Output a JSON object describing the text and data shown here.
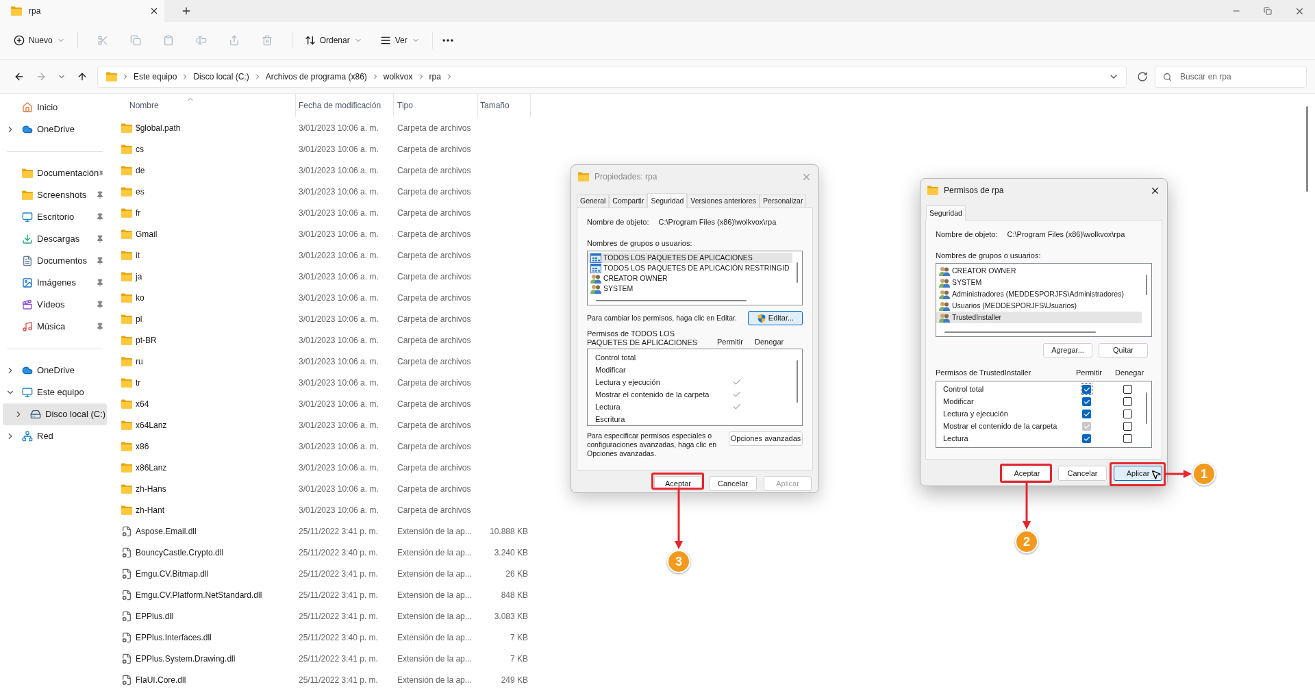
{
  "window": {
    "tab_title": "rpa"
  },
  "toolbar": {
    "new": "Nuevo",
    "sort": "Ordenar",
    "view": "Ver"
  },
  "address": {
    "path": [
      "Este equipo",
      "Disco local (C:)",
      "Archivos de programa (x86)",
      "wolkvox",
      "rpa"
    ],
    "search_placeholder": "Buscar en rpa"
  },
  "sidebar": {
    "groups": [
      {
        "items": [
          {
            "label": "Inicio",
            "kind": "home",
            "pinned": false,
            "expandable": false,
            "expanded": false,
            "selected": false
          },
          {
            "label": "OneDrive",
            "kind": "cloud",
            "pinned": false,
            "expandable": true,
            "expanded": false,
            "selected": false
          }
        ]
      },
      {
        "items": [
          {
            "label": "Documentación",
            "kind": "folder",
            "pinned": true,
            "expandable": false,
            "expanded": false,
            "selected": false
          },
          {
            "label": "Screenshots",
            "kind": "folder",
            "pinned": true,
            "expandable": false,
            "expanded": false,
            "selected": false
          },
          {
            "label": "Escritorio",
            "kind": "desktop",
            "pinned": true,
            "expandable": false,
            "expanded": false,
            "selected": false
          },
          {
            "label": "Descargas",
            "kind": "download",
            "pinned": true,
            "expandable": false,
            "expanded": false,
            "selected": false
          },
          {
            "label": "Documentos",
            "kind": "document",
            "pinned": true,
            "expandable": false,
            "expanded": false,
            "selected": false
          },
          {
            "label": "Imágenes",
            "kind": "image",
            "pinned": true,
            "expandable": false,
            "expanded": false,
            "selected": false
          },
          {
            "label": "Vídeos",
            "kind": "video",
            "pinned": true,
            "expandable": false,
            "expanded": false,
            "selected": false
          },
          {
            "label": "Música",
            "kind": "music",
            "pinned": true,
            "expandable": false,
            "expanded": false,
            "selected": false
          }
        ]
      },
      {
        "items": [
          {
            "label": "OneDrive",
            "kind": "cloud",
            "pinned": false,
            "expandable": true,
            "expanded": false,
            "selected": false
          },
          {
            "label": "Este equipo",
            "kind": "pc",
            "pinned": false,
            "expandable": true,
            "expanded": true,
            "selected": false,
            "children": [
              {
                "label": "Disco local (C:)",
                "kind": "drive",
                "expandable": true,
                "expanded": false,
                "selected": true
              }
            ]
          },
          {
            "label": "Red",
            "kind": "network",
            "pinned": false,
            "expandable": true,
            "expanded": false,
            "selected": false
          }
        ]
      }
    ]
  },
  "table": {
    "columns": [
      "Nombre",
      "Fecha de modificación",
      "Tipo",
      "Tamaño"
    ],
    "rows": [
      {
        "kind": "folder",
        "name": "$global.path",
        "date": "3/01/2023 10:06 a. m.",
        "type": "Carpeta de archivos"
      },
      {
        "kind": "folder",
        "name": "cs",
        "date": "3/01/2023 10:06 a. m.",
        "type": "Carpeta de archivos"
      },
      {
        "kind": "folder",
        "name": "de",
        "date": "3/01/2023 10:06 a. m.",
        "type": "Carpeta de archivos"
      },
      {
        "kind": "folder",
        "name": "es",
        "date": "3/01/2023 10:06 a. m.",
        "type": "Carpeta de archivos"
      },
      {
        "kind": "folder",
        "name": "fr",
        "date": "3/01/2023 10:06 a. m.",
        "type": "Carpeta de archivos"
      },
      {
        "kind": "folder",
        "name": "Gmail",
        "date": "3/01/2023 10:06 a. m.",
        "type": "Carpeta de archivos"
      },
      {
        "kind": "folder",
        "name": "it",
        "date": "3/01/2023 10:06 a. m.",
        "type": "Carpeta de archivos"
      },
      {
        "kind": "folder",
        "name": "ja",
        "date": "3/01/2023 10:06 a. m.",
        "type": "Carpeta de archivos"
      },
      {
        "kind": "folder",
        "name": "ko",
        "date": "3/01/2023 10:06 a. m.",
        "type": "Carpeta de archivos"
      },
      {
        "kind": "folder",
        "name": "pl",
        "date": "3/01/2023 10:06 a. m.",
        "type": "Carpeta de archivos"
      },
      {
        "kind": "folder",
        "name": "pt-BR",
        "date": "3/01/2023 10:06 a. m.",
        "type": "Carpeta de archivos"
      },
      {
        "kind": "folder",
        "name": "ru",
        "date": "3/01/2023 10:06 a. m.",
        "type": "Carpeta de archivos"
      },
      {
        "kind": "folder",
        "name": "tr",
        "date": "3/01/2023 10:06 a. m.",
        "type": "Carpeta de archivos"
      },
      {
        "kind": "folder",
        "name": "x64",
        "date": "3/01/2023 10:06 a. m.",
        "type": "Carpeta de archivos"
      },
      {
        "kind": "folder",
        "name": "x64Lanz",
        "date": "3/01/2023 10:06 a. m.",
        "type": "Carpeta de archivos"
      },
      {
        "kind": "folder",
        "name": "x86",
        "date": "3/01/2023 10:06 a. m.",
        "type": "Carpeta de archivos"
      },
      {
        "kind": "folder",
        "name": "x86Lanz",
        "date": "3/01/2023 10:06 a. m.",
        "type": "Carpeta de archivos"
      },
      {
        "kind": "folder",
        "name": "zh-Hans",
        "date": "3/01/2023 10:06 a. m.",
        "type": "Carpeta de archivos"
      },
      {
        "kind": "folder",
        "name": "zh-Hant",
        "date": "3/01/2023 10:06 a. m.",
        "type": "Carpeta de archivos"
      },
      {
        "kind": "dll",
        "name": "Aspose.Email.dll",
        "date": "25/11/2022 3:41 p. m.",
        "type": "Extensión de la ap...",
        "size": "10.888 KB"
      },
      {
        "kind": "dll",
        "name": "BouncyCastle.Crypto.dll",
        "date": "25/11/2022 3:40 p. m.",
        "type": "Extensión de la ap...",
        "size": "3.240 KB"
      },
      {
        "kind": "dll",
        "name": "Emgu.CV.Bitmap.dll",
        "date": "25/11/2022 3:41 p. m.",
        "type": "Extensión de la ap...",
        "size": "26 KB"
      },
      {
        "kind": "dll",
        "name": "Emgu.CV.Platform.NetStandard.dll",
        "date": "25/11/2022 3:41 p. m.",
        "type": "Extensión de la ap...",
        "size": "848 KB"
      },
      {
        "kind": "dll",
        "name": "EPPlus.dll",
        "date": "25/11/2022 3:41 p. m.",
        "type": "Extensión de la ap...",
        "size": "3.083 KB"
      },
      {
        "kind": "dll",
        "name": "EPPlus.Interfaces.dll",
        "date": "25/11/2022 3:40 p. m.",
        "type": "Extensión de la ap...",
        "size": "7 KB"
      },
      {
        "kind": "dll",
        "name": "EPPlus.System.Drawing.dll",
        "date": "25/11/2022 3:41 p. m.",
        "type": "Extensión de la ap...",
        "size": "7 KB"
      },
      {
        "kind": "dll",
        "name": "FlaUI.Core.dll",
        "date": "25/11/2022 3:41 p. m.",
        "type": "Extensión de la ap...",
        "size": "249 KB"
      }
    ]
  },
  "properties_dialog": {
    "title": "Propiedades: rpa",
    "active": false,
    "tabs": [
      {
        "label": "General",
        "selected": false
      },
      {
        "label": "Compartir",
        "selected": false
      },
      {
        "label": "Seguridad",
        "selected": true
      },
      {
        "label": "Versiones anteriores",
        "selected": false
      },
      {
        "label": "Personalizar",
        "selected": false
      }
    ],
    "object_label": "Nombre de objeto:",
    "object_path": "C:\\Program Files (x86)\\wolkvox\\rpa",
    "groups_label": "Nombres de grupos o usuarios:",
    "groups": [
      {
        "name": "TODOS LOS PAQUETES DE APLICACIONES",
        "kind": "package",
        "selected": true
      },
      {
        "name": "TODOS LOS PAQUETES DE APLICACIÓN RESTRINGID",
        "kind": "package",
        "selected": false
      },
      {
        "name": "CREATOR OWNER",
        "kind": "users",
        "selected": false
      },
      {
        "name": "SYSTEM",
        "kind": "users",
        "selected": false
      }
    ],
    "edit_hint": "Para cambiar los permisos, haga clic en Editar.",
    "edit_button": "Editar...",
    "permissions_label": "Permisos de TODOS LOS PAQUETES DE APLICACIONES",
    "allow_header": "Permitir",
    "deny_header": "Denegar",
    "permissions": [
      {
        "name": "Control total",
        "allow": false,
        "deny": false
      },
      {
        "name": "Modificar",
        "allow": false,
        "deny": false
      },
      {
        "name": "Lectura y ejecución",
        "allow": true,
        "deny": false
      },
      {
        "name": "Mostrar el contenido de la carpeta",
        "allow": true,
        "deny": false
      },
      {
        "name": "Lectura",
        "allow": true,
        "deny": false
      },
      {
        "name": "Escritura",
        "allow": false,
        "deny": false
      }
    ],
    "advanced_hint": "Para especificar permisos especiales o configuraciones avanzadas, haga clic en Opciones avanzadas.",
    "advanced_button": "Opciones avanzadas",
    "buttons": [
      {
        "label": "Aceptar",
        "disabled": false
      },
      {
        "label": "Cancelar",
        "disabled": false
      },
      {
        "label": "Aplicar",
        "disabled": true
      }
    ]
  },
  "permissions_dialog": {
    "title": "Permisos de rpa",
    "active": true,
    "tabs": [
      {
        "label": "Seguridad",
        "selected": true
      }
    ],
    "object_label": "Nombre de objeto:",
    "object_path": "C:\\Program Files (x86)\\wolkvox\\rpa",
    "groups_label": "Nombres de grupos o usuarios:",
    "groups": [
      {
        "name": "CREATOR OWNER",
        "kind": "users",
        "selected": false
      },
      {
        "name": "SYSTEM",
        "kind": "users",
        "selected": false
      },
      {
        "name": "Administradores (MEDDESPORJFS\\Administradores)",
        "kind": "users",
        "selected": false
      },
      {
        "name": "Usuarios (MEDDESPORJFS\\Usuarios)",
        "kind": "users",
        "selected": false
      },
      {
        "name": "TrustedInstaller",
        "kind": "users",
        "selected": true
      }
    ],
    "add_button": "Agregar...",
    "remove_button": "Quitar",
    "permissions_label": "Permisos de TrustedInstaller",
    "allow_header": "Permitir",
    "deny_header": "Denegar",
    "permissions": [
      {
        "name": "Control total",
        "allow": true,
        "allow_disabled": false,
        "deny": false,
        "focused": true
      },
      {
        "name": "Modificar",
        "allow": true,
        "allow_disabled": false,
        "deny": false,
        "focused": false
      },
      {
        "name": "Lectura y ejecución",
        "allow": true,
        "allow_disabled": false,
        "deny": false,
        "focused": false
      },
      {
        "name": "Mostrar el contenido de la carpeta",
        "allow": true,
        "allow_disabled": true,
        "deny": false,
        "focused": false
      },
      {
        "name": "Lectura",
        "allow": true,
        "allow_disabled": false,
        "deny": false,
        "focused": false
      }
    ],
    "buttons": [
      {
        "label": "Aceptar",
        "disabled": false,
        "focused": false
      },
      {
        "label": "Cancelar",
        "disabled": false,
        "focused": false
      },
      {
        "label": "Aplicar",
        "disabled": false,
        "focused": true
      }
    ]
  },
  "callouts": [
    {
      "number": "1"
    },
    {
      "number": "2"
    },
    {
      "number": "3"
    }
  ]
}
